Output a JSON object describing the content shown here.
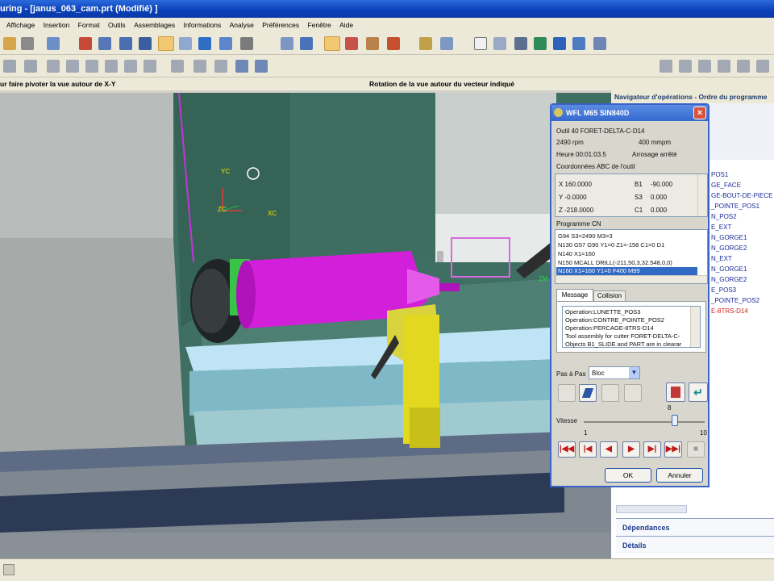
{
  "window": {
    "title": "uring - [janus_063_cam.prt (Modifié) ]"
  },
  "menu": [
    "Affichage",
    "Insertion",
    "Format",
    "Outils",
    "Assemblages",
    "Informations",
    "Analyse",
    "Préférences",
    "Fenêtre",
    "Aide"
  ],
  "status": {
    "left": "ur faire pivoter la vue autour de X-Y",
    "center": "Rotation de la vue autour du vecteur indiqué"
  },
  "viewport": {
    "axis_labels": [
      "YC",
      "ZC",
      "XC",
      "ZM"
    ]
  },
  "navigator": {
    "header": "Navigateur d'opérations - Ordre du programme",
    "items": [
      "POS1",
      "GE_FACE",
      "GE-BOUT-DE-PIECE",
      "_POINTE_POS1",
      "N_POS2",
      "E_EXT",
      "N_GORGE1",
      "N_GORGE2",
      "N_EXT",
      "N_GORGE1",
      "N_GORGE2",
      "E_POS3",
      "_POINTE_POS2",
      "E-8TRS-D14"
    ],
    "sections": [
      "Dépendances",
      "Détails"
    ]
  },
  "dialog": {
    "title": "WFL M65 SIN840D",
    "tool_line": "Outil 40   FORET-DELTA-C-D14",
    "rpm": "2490 rpm",
    "feed": "400 mmpm",
    "time": "Heure 00:01:03.5",
    "coolant": "Arrosage arrêté",
    "coords_label": "Coordonnées ABC de l'outil",
    "coords": [
      {
        "axis": "X 160.0000",
        "b": "B1",
        "bval": "-90.000"
      },
      {
        "axis": "Y -0.0000",
        "b": "S3",
        "bval": "0.000"
      },
      {
        "axis": "Z -218.0000",
        "b": "C1",
        "bval": "0.000"
      }
    ],
    "program_label": "Programme CN",
    "program_lines": [
      "G94 S3=2490 M3=3",
      "N130 G57 G90 Y1=0 Z1=-158 C1=0 D1",
      "N140 X1=160",
      "N150 MCALL DRILL(-211,50,3,32.548,0,0)",
      "N160 X1=160 Y1=0 F400 M99"
    ],
    "tabs": [
      "Message",
      "Collision"
    ],
    "messages": [
      "Operation:LUNETTE_POS3",
      "Operation:CONTRE_POINTE_POS2",
      "Operation:PERCAGE-8TRS-D14",
      "Tool assembly for cutter FORET-DELTA-C-",
      "Objects B1_SLIDE and PART are in clearar"
    ],
    "step_label": "Pas à Pas",
    "step_value": "Bloc",
    "speed_label": "Vitesse",
    "speed_value": "8",
    "speed_min": "1",
    "speed_max": "10",
    "ok": "OK",
    "cancel": "Annuler"
  }
}
